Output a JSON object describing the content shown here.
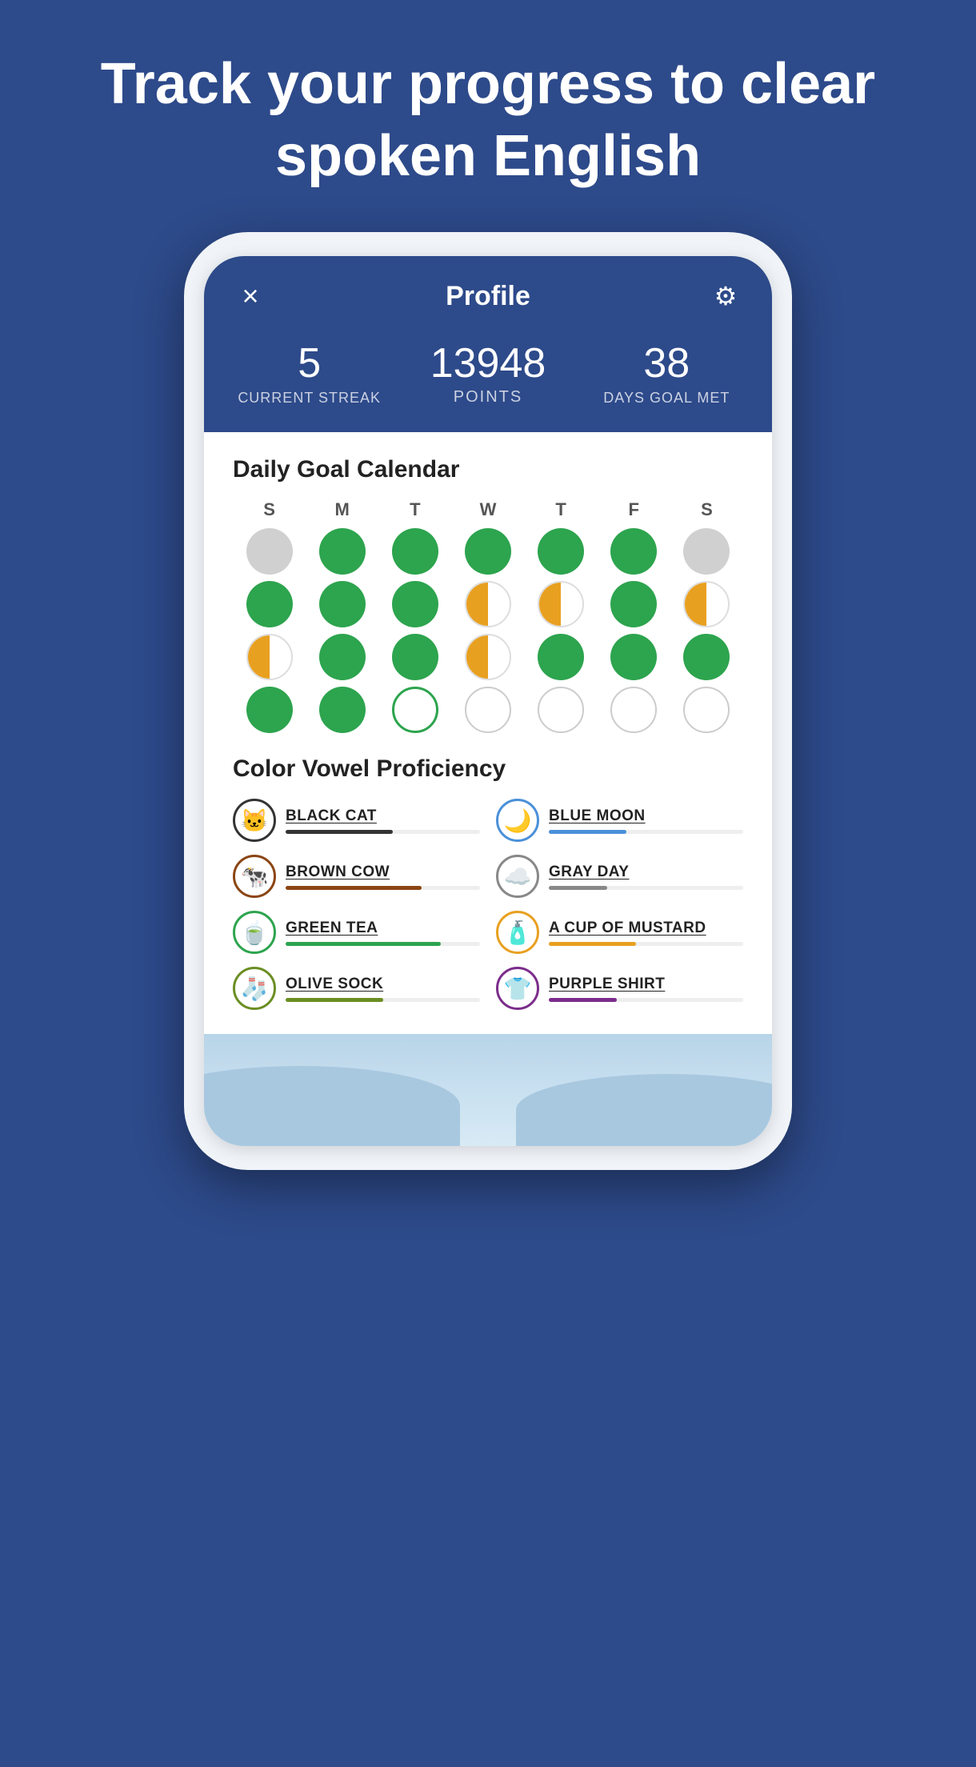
{
  "hero": {
    "title": "Track your progress to clear spoken English"
  },
  "app": {
    "header": {
      "close_label": "×",
      "title": "Profile",
      "settings_label": "⚙"
    },
    "stats": {
      "streak": {
        "value": "5",
        "label": "CURRENT STREAK"
      },
      "points": {
        "value": "13948",
        "label": "POINTS"
      },
      "days": {
        "value": "38",
        "label": "DAYS GOAL MET"
      }
    },
    "calendar": {
      "title": "Daily Goal Calendar",
      "day_labels": [
        "S",
        "M",
        "T",
        "W",
        "T",
        "F",
        "S"
      ],
      "rows": [
        [
          "gray",
          "green",
          "green",
          "green",
          "green",
          "green",
          "gray"
        ],
        [
          "green",
          "green",
          "green",
          "half",
          "half",
          "green",
          "half"
        ],
        [
          "half",
          "green",
          "green",
          "half",
          "green",
          "green",
          "green"
        ],
        [
          "green",
          "green",
          "current",
          "empty",
          "empty",
          "empty",
          "empty"
        ]
      ]
    },
    "vowel_proficiency": {
      "title": "Color Vowel Proficiency",
      "items": [
        {
          "name": "BLACK CAT",
          "icon": "🐱",
          "icon_color": "#333",
          "bar_color": "#333",
          "bar_width": "55%",
          "side": "left"
        },
        {
          "name": "BLUE MOON",
          "icon": "🌙",
          "icon_color": "#4a90d9",
          "bar_color": "#4a90d9",
          "bar_width": "40%",
          "side": "right"
        },
        {
          "name": "BROWN COW",
          "icon": "🐄",
          "icon_color": "#8B4513",
          "bar_color": "#8B4513",
          "bar_width": "70%",
          "side": "left"
        },
        {
          "name": "GRAY DAY",
          "icon": "☁",
          "icon_color": "#888",
          "bar_color": "#888",
          "bar_width": "30%",
          "side": "right"
        },
        {
          "name": "GREEN TEA",
          "icon": "🍵",
          "icon_color": "#2da44e",
          "bar_color": "#2da44e",
          "bar_width": "80%",
          "side": "left"
        },
        {
          "name": "A CUP OF MUSTARD",
          "icon": "🟡",
          "icon_color": "#e8a020",
          "bar_color": "#e8a020",
          "bar_width": "45%",
          "side": "right"
        },
        {
          "name": "OLIVE SOCK",
          "icon": "🧦",
          "icon_color": "#6b8e23",
          "bar_color": "#6b8e23",
          "bar_width": "50%",
          "side": "left"
        },
        {
          "name": "PURPLE SHIRT",
          "icon": "👕",
          "icon_color": "#7b2d8b",
          "bar_color": "#7b2d8b",
          "bar_width": "35%",
          "side": "right"
        }
      ]
    }
  }
}
